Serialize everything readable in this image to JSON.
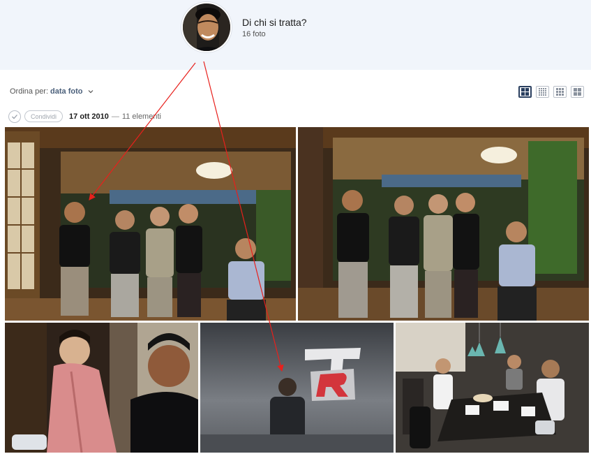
{
  "person": {
    "title": "Di chi si tratta?",
    "count": "16 foto",
    "avatar_icon": "person-face-avatar"
  },
  "sort": {
    "label": "Ordina per:",
    "value": "data foto",
    "icon": "chevron-down-icon"
  },
  "view_toggles": [
    {
      "name": "large-grid",
      "active": true
    },
    {
      "name": "medium-grid",
      "active": false
    },
    {
      "name": "small-grid",
      "active": false
    },
    {
      "name": "compact-grid",
      "active": false
    }
  ],
  "group": {
    "share_label": "Condividi",
    "date": "17 ott 2010",
    "separator": "—",
    "count": "11 elementi"
  },
  "colors": {
    "header_bg": "#f1f5fb",
    "accent": "#2a3f5f",
    "annotation": "#e8201c"
  }
}
